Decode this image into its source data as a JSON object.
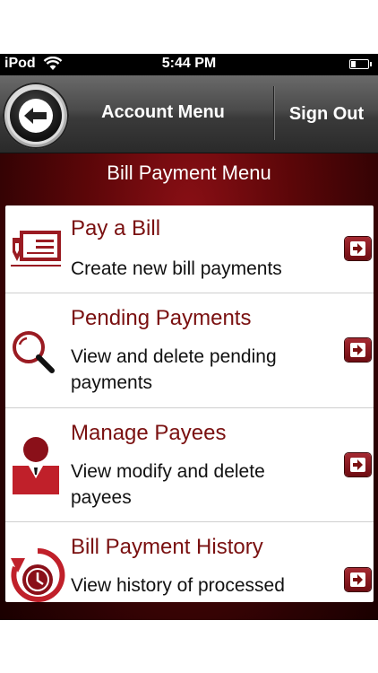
{
  "status_bar": {
    "carrier": "iPod",
    "time": "5:44 PM",
    "battery_level": 0.3
  },
  "nav_bar": {
    "back_icon": "back-arrow-icon",
    "title": "Account Menu",
    "sign_out_label": "Sign Out"
  },
  "section_title": "Bill Payment Menu",
  "menu": {
    "items": [
      {
        "title": "Pay a Bill",
        "description": "Create new bill payments",
        "icon": "bill-check-icon"
      },
      {
        "title": "Pending Payments",
        "description": "View and delete pending payments",
        "icon": "magnifier-icon"
      },
      {
        "title": "Manage Payees",
        "description": "View modify and delete payees",
        "icon": "person-icon"
      },
      {
        "title": "Bill Payment History",
        "description": "View history of processed",
        "icon": "clock-history-icon"
      }
    ]
  },
  "colors": {
    "accent_maroon": "#7a1010",
    "background_maroon": "#5a0608",
    "arrow_button": "#8a1820"
  }
}
